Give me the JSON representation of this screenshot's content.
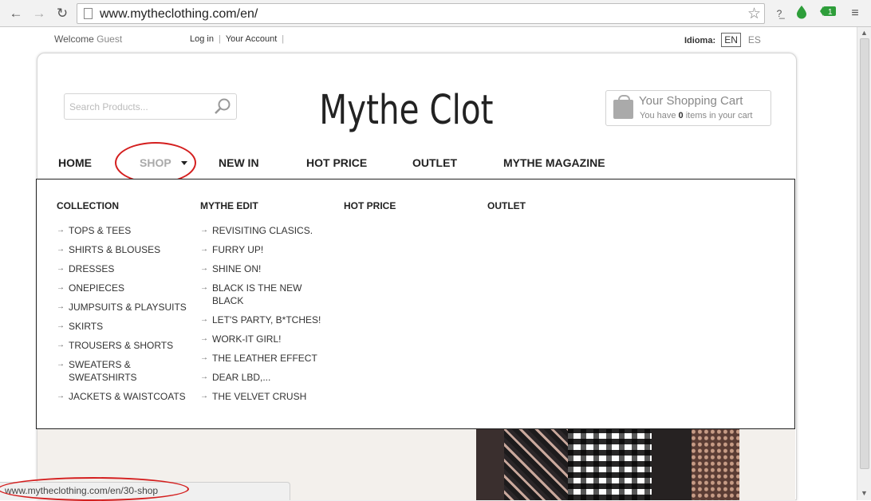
{
  "browser": {
    "url": "www.mytheclothing.com/en/",
    "back_icon": "back-arrow-icon",
    "forward_icon": "forward-arrow-icon",
    "reload_icon": "reload-icon",
    "ext2_badge": "1"
  },
  "topbar": {
    "welcome": "Welcome",
    "guest": "Guest",
    "login": "Log in",
    "account": "Your Account",
    "idioma_label": "Idioma:",
    "lang_en": "EN",
    "lang_es": "ES"
  },
  "header": {
    "search_placeholder": "Search Products...",
    "logo_text": "Mythe Clothing",
    "cart_title": "Your Shopping Cart",
    "cart_prefix": "You have",
    "cart_count": "0",
    "cart_suffix": "items in your cart"
  },
  "nav": {
    "home": "HOME",
    "shop": "SHOP",
    "new_in": "NEW IN",
    "hot_price": "HOT PRICE",
    "outlet": "OUTLET",
    "magazine": "MYTHE MAGAZINE"
  },
  "dropdown": {
    "collection": {
      "head": "COLLECTION",
      "items": [
        "TOPS & TEES",
        "SHIRTS & BLOUSES",
        "DRESSES",
        "ONEPIECES",
        "JUMPSUITS & PLAYSUITS",
        "SKIRTS",
        "TROUSERS & SHORTS",
        "SWEATERS & SWEATSHIRTS",
        "JACKETS & WAISTCOATS"
      ]
    },
    "edit": {
      "head": "MYTHE EDIT",
      "items": [
        "REVISITING CLASICS.",
        "FURRY UP!",
        "SHINE ON!",
        "BLACK IS THE NEW BLACK",
        "LET'S PARTY, B*TCHES!",
        "WORK-IT GIRL!",
        "THE LEATHER EFFECT",
        "DEAR LBD,...",
        "THE VELVET CRUSH"
      ]
    },
    "hot_price_head": "HOT PRICE",
    "outlet_head": "OUTLET"
  },
  "status": {
    "url": "www.mytheclothing.com/en/30-shop"
  },
  "colors": {
    "annotation_red": "#d41f1f",
    "accent_green": "#2e9e3a"
  }
}
